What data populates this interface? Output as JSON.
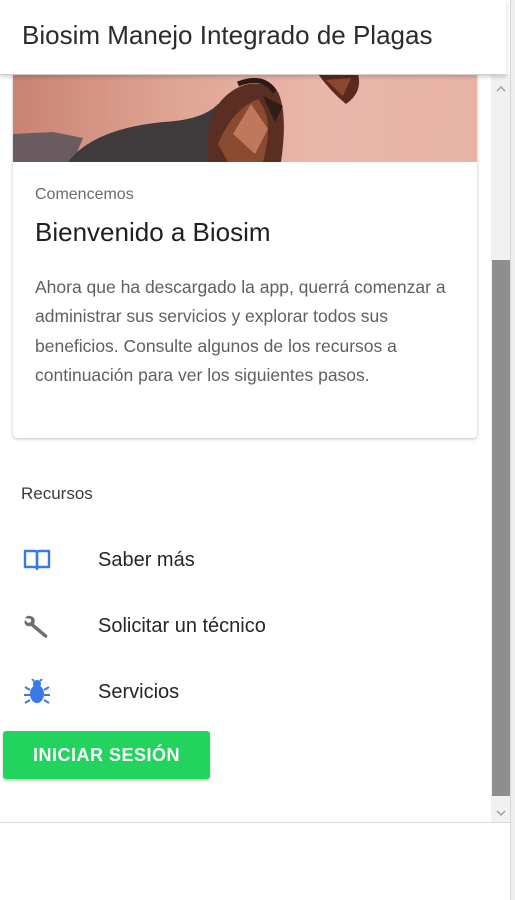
{
  "app": {
    "title": "Biosim Manejo Integrado de Plagas"
  },
  "card": {
    "overline": "Comencemos",
    "title": "Bienvenido a Biosim",
    "body": "Ahora que ha descargado la app, querrá comenzar a administrar sus servicios y explorar todos sus beneficios. Consulte algunos de los recursos a continuación para ver los siguientes pasos."
  },
  "resources": {
    "label": "Recursos",
    "items": [
      {
        "label": "Saber más",
        "icon": "book-open-icon",
        "color": "#3b78e7"
      },
      {
        "label": "Solicitar un técnico",
        "icon": "wrench-icon",
        "color": "#6f6f6f"
      },
      {
        "label": "Servicios",
        "icon": "bug-icon",
        "color": "#3b78e7"
      }
    ]
  },
  "login_button": {
    "label": "INICIAR SESIÓN",
    "color": "#22d45e"
  },
  "colors": {
    "accent": "#3b78e7",
    "primary_button": "#22d45e"
  }
}
